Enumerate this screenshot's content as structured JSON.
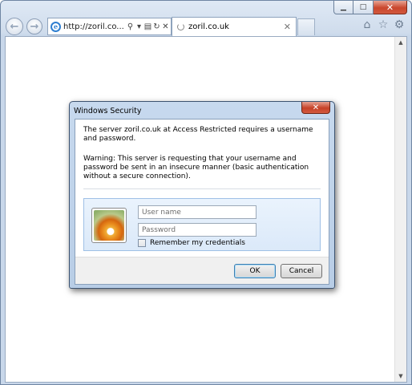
{
  "browser": {
    "address_url": "http://zoril.co....",
    "tab_title": "zoril.co.uk",
    "caption": {
      "minimize": "▭",
      "maximize": "□",
      "close": "✕"
    },
    "icons": [
      "back-arrow-icon",
      "forward-arrow-icon",
      "ie-logo-icon",
      "search-icon",
      "dropdown-icon",
      "compat-view-icon",
      "refresh-icon",
      "stop-icon",
      "home-icon",
      "favorites-star-icon",
      "tools-gear-icon"
    ]
  },
  "dialog": {
    "title": "Windows Security",
    "message": "The server zoril.co.uk at Access Restricted requires a username and password.",
    "warning": "Warning: This server is requesting that your username and password be sent in an insecure manner (basic authentication without a secure connection).",
    "username_placeholder": "User name",
    "password_placeholder": "Password",
    "remember_label": "Remember my credentials",
    "ok_label": "OK",
    "cancel_label": "Cancel"
  }
}
